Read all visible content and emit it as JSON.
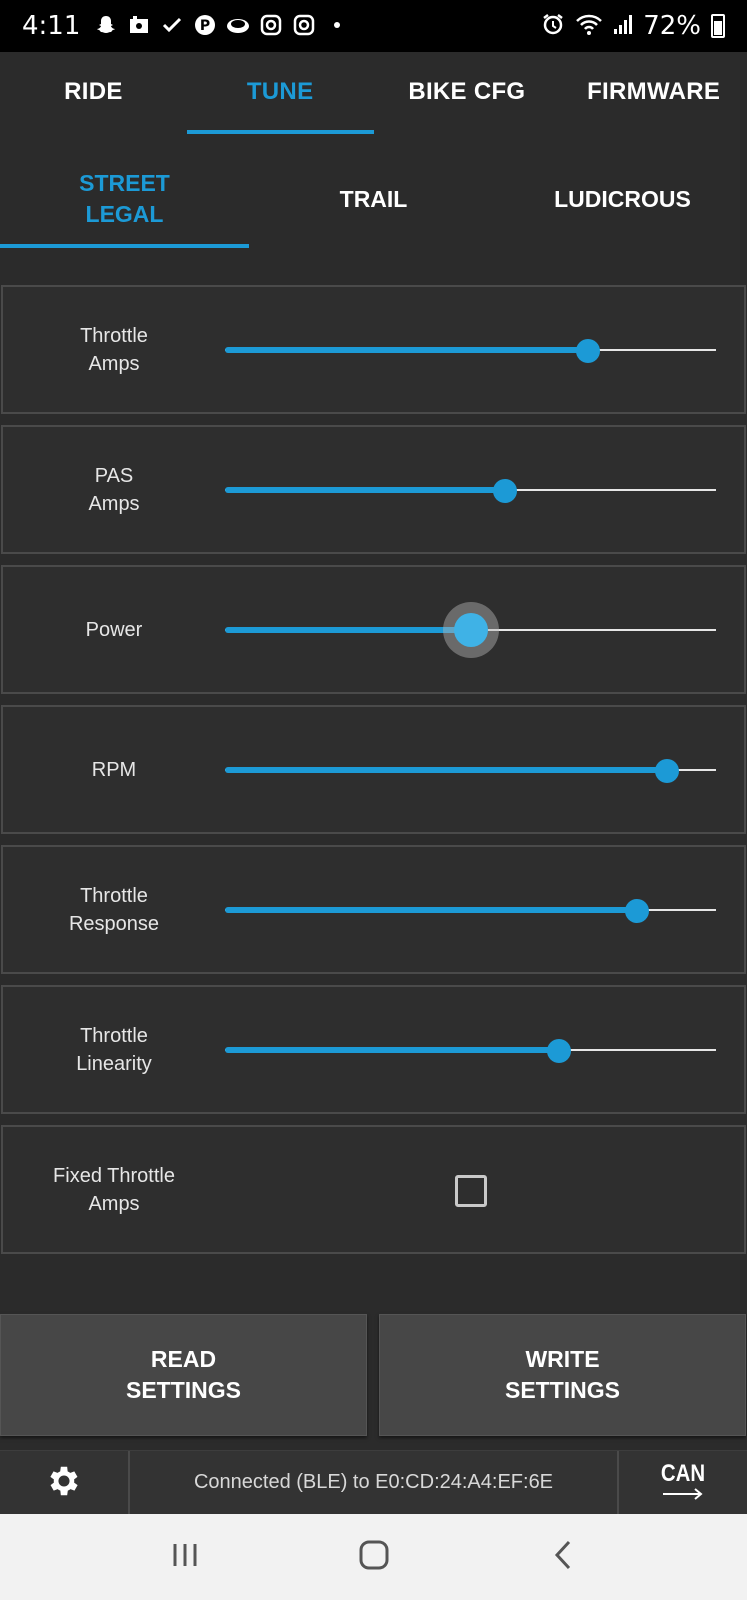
{
  "status_bar": {
    "time": "4:11",
    "battery": "72%",
    "notification_icons": [
      "snapchat-icon",
      "photos-icon",
      "checkmark-icon",
      "pinterest-icon",
      "cloud-icon",
      "instagram-icon",
      "instagram-icon",
      "dot-icon"
    ]
  },
  "top_tabs": [
    "RIDE",
    "TUNE",
    "BIKE CFG",
    "FIRMWARE"
  ],
  "top_tabs_active": "TUNE",
  "mode_tabs": {
    "street": "STREET\nLEGAL",
    "trail": "TRAIL",
    "ludicrous": "LUDICROUS",
    "active": "STREET LEGAL"
  },
  "settings": {
    "throttle_amps": {
      "label": "Throttle\nAmps",
      "value_fraction": 0.74
    },
    "pas_amps": {
      "label": "PAS\nAmps",
      "value_fraction": 0.57
    },
    "power": {
      "label": "Power",
      "value_fraction": 0.5
    },
    "rpm": {
      "label": "RPM",
      "value_fraction": 0.9
    },
    "throttle_response": {
      "label": "Throttle\nResponse",
      "value_fraction": 0.84
    },
    "throttle_linearity": {
      "label": "Throttle\nLinearity",
      "value_fraction": 0.68
    },
    "fixed_throttle_amps": {
      "label": "Fixed Throttle\nAmps",
      "checked": false
    }
  },
  "buttons": {
    "read": "READ\nSETTINGS",
    "write": "WRITE\nSETTINGS"
  },
  "bottom_bar": {
    "connection_status": "Connected (BLE) to E0:CD:24:A4:EF:6E",
    "can_label": "CAN"
  },
  "colors": {
    "accent": "#1c9ad6",
    "background": "#2b2b2b",
    "row_border": "#4a4a4a",
    "button": "#474747"
  }
}
